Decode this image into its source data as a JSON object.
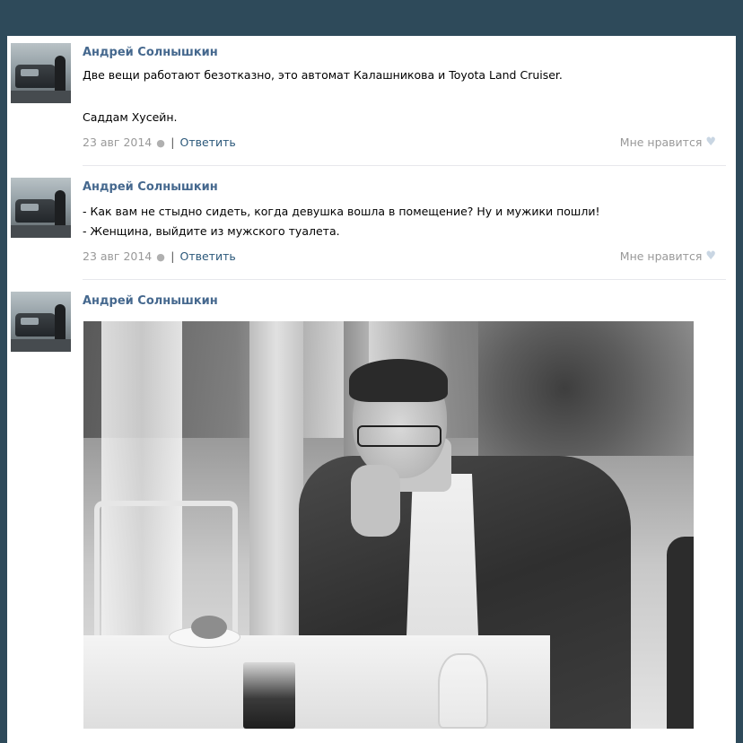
{
  "posts": [
    {
      "author": "Андрей Солнышкин",
      "lines": [
        "Две вещи работают безотказно, это автомат Калашникова и Toyota Land Cruiser.",
        "",
        "Саддам Хусейн."
      ],
      "date": "23 авг 2014",
      "reply": "Ответить",
      "like": "Мне нравится"
    },
    {
      "author": "Андрей Солнышкин",
      "lines": [
        "- Как вам не стыдно сидеть, когда девушка вошла в помещение? Ну и мужики пошли!",
        "- Женщина, выйдите из мужского туалета."
      ],
      "date": "23 авг 2014",
      "reply": "Ответить",
      "like": "Мне нравится"
    },
    {
      "author": "Андрей Солнышкин",
      "photo": "man-in-suit-photo"
    }
  ],
  "icons": {
    "platform": "apple-icon",
    "like": "heart-icon"
  },
  "colors": {
    "background": "#2e4a5a",
    "author": "#45688e",
    "reply": "#2b587a",
    "meta": "#999999"
  }
}
